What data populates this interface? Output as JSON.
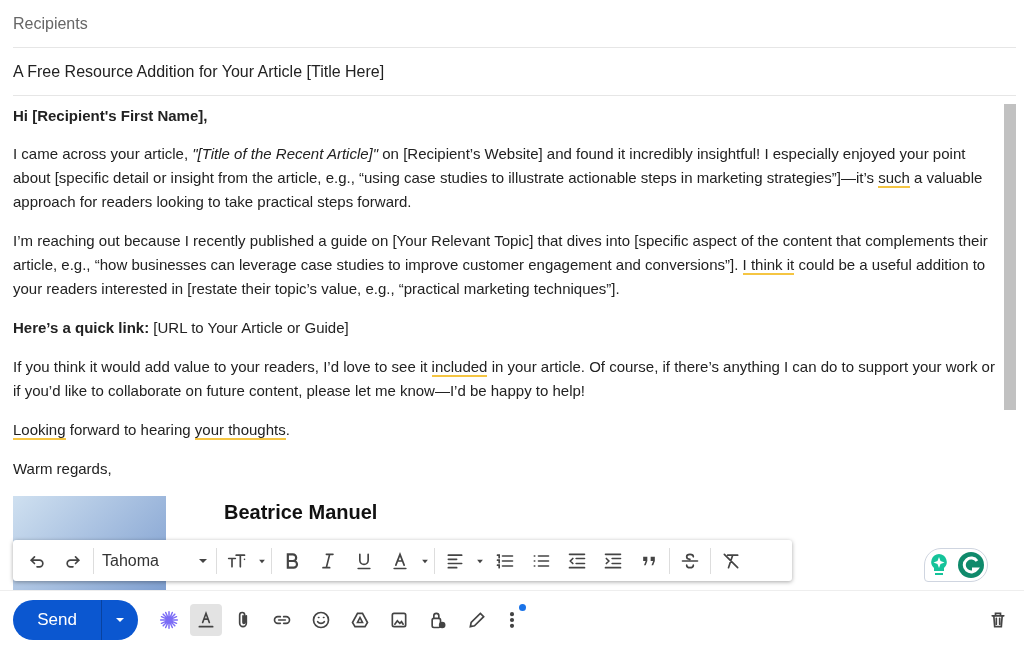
{
  "recipients": {
    "placeholder": "Recipients"
  },
  "subject": {
    "value": "A Free Resource Addition for Your Article [Title Here]"
  },
  "body": [
    {
      "kind": "greeting",
      "segments": [
        {
          "text": "Hi [Recipient's First Name],",
          "flagged": false
        }
      ]
    },
    {
      "kind": "paragraph",
      "segments": [
        {
          "text": "I came across your article, *\"[Title of the Recent Article]\"* on [Recipient’s Website] and found it incredibly insightful! I especially enjoyed your point about [specific detail or insight from the article, e.g., “using case studies to illustrate actionable steps in marketing strategies”]—it’s ",
          "flagged": false
        },
        {
          "text": "such",
          "flagged": true
        },
        {
          "text": " a valuable approach for readers looking to take practical steps forward.",
          "flagged": false
        }
      ]
    },
    {
      "kind": "paragraph",
      "segments": [
        {
          "text": "I’m reaching out because I recently published a guide on [Your Relevant Topic] that dives into [specific aspect of the content that complements their article, e.g., “how businesses can leverage case studies to improve customer engagement and conversions”]. ",
          "flagged": false
        },
        {
          "text": "I think it",
          "flagged": true
        },
        {
          "text": " could be a useful addition to your readers interested in [restate their topic’s value, e.g., “practical marketing techniques”].",
          "flagged": false
        }
      ]
    },
    {
      "kind": "paragraph",
      "segments": [
        {
          "text": "**Here’s a quick link:** [URL to Your Article or Guide]",
          "flagged": false
        }
      ]
    },
    {
      "kind": "paragraph",
      "segments": [
        {
          "text": "If you think it would add value to your readers, I’d love to see it ",
          "flagged": false
        },
        {
          "text": "included",
          "flagged": true
        },
        {
          "text": " in your article. Of course, if there’s anything I can do to support your work or if you’d like to collaborate on future content, please let me know—I’d be happy to help!",
          "flagged": false
        }
      ]
    },
    {
      "kind": "paragraph",
      "segments": [
        {
          "text": "Looking",
          "flagged": true
        },
        {
          "text": " forward to hearing ",
          "flagged": false
        },
        {
          "text": "your thoughts",
          "flagged": true
        },
        {
          "text": ".",
          "flagged": false
        }
      ]
    },
    {
      "kind": "paragraph",
      "segments": [
        {
          "text": "Warm regards,",
          "flagged": false
        }
      ]
    }
  ],
  "signature": {
    "name": "Beatrice Manuel"
  },
  "format_toolbar": {
    "font": "Tahoma"
  },
  "send_button": {
    "label": "Send"
  }
}
